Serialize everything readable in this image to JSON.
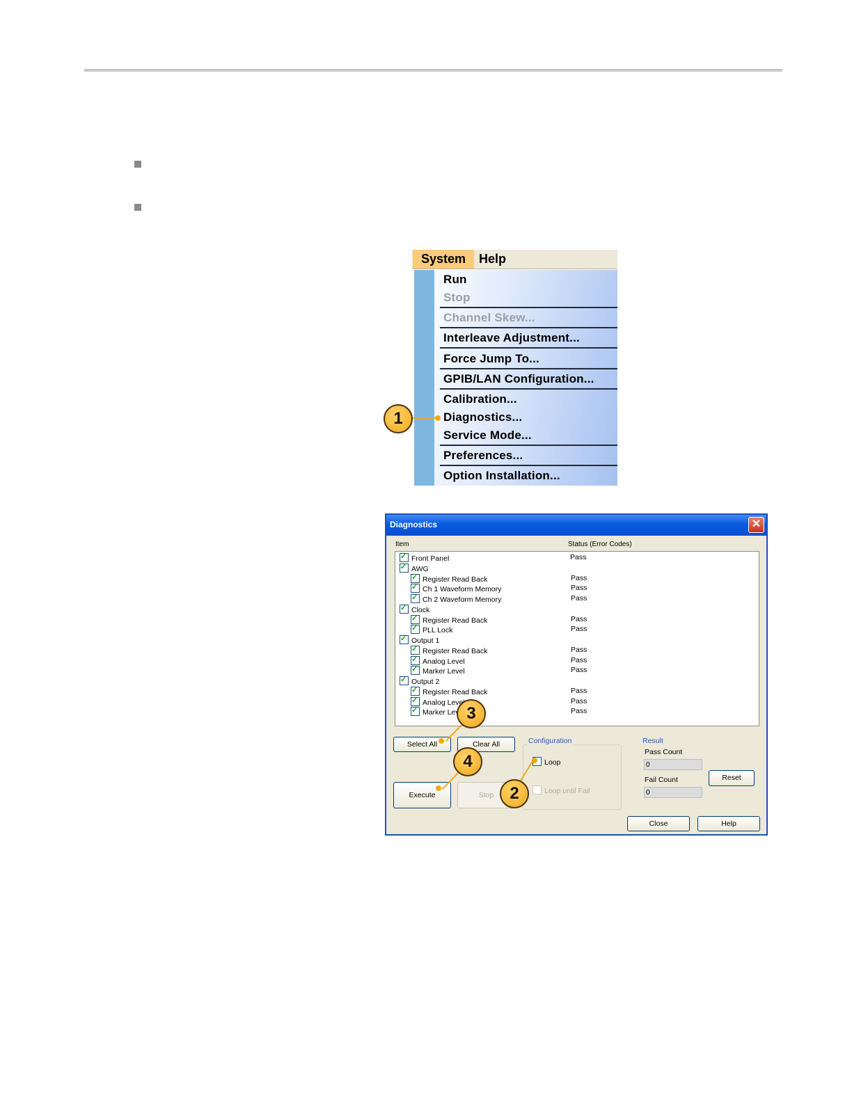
{
  "menu": {
    "bar": [
      "System",
      "Help"
    ],
    "items": [
      {
        "label": "Run",
        "enabled": true
      },
      {
        "label": "Stop",
        "enabled": false
      },
      {
        "label": "Channel Skew...",
        "enabled": false
      },
      {
        "label": "Interleave Adjustment...",
        "enabled": true
      },
      {
        "label": "Force Jump To...",
        "enabled": true
      },
      {
        "label": "GPIB/LAN Configuration...",
        "enabled": true
      },
      {
        "label": "Calibration...",
        "enabled": true
      },
      {
        "label": "Diagnostics...",
        "enabled": true
      },
      {
        "label": "Service Mode...",
        "enabled": true
      },
      {
        "label": "Preferences...",
        "enabled": true
      },
      {
        "label": "Option Installation...",
        "enabled": true
      }
    ]
  },
  "callouts": [
    "1",
    "2",
    "3",
    "4"
  ],
  "dialog": {
    "title": "Diagnostics",
    "close_glyph": "✕",
    "col_item": "Item",
    "col_status": "Status (Error Codes)",
    "rows": [
      {
        "label": "Front Panel",
        "status": "Pass",
        "level": 0
      },
      {
        "label": "AWG",
        "status": "",
        "level": 0
      },
      {
        "label": "Register Read Back",
        "status": "Pass",
        "level": 1
      },
      {
        "label": "Ch 1 Waveform Memory",
        "status": "Pass",
        "level": 1
      },
      {
        "label": "Ch 2 Waveform Memory",
        "status": "Pass",
        "level": 1
      },
      {
        "label": "Clock",
        "status": "",
        "level": 0
      },
      {
        "label": "Register Read Back",
        "status": "Pass",
        "level": 1
      },
      {
        "label": "PLL Lock",
        "status": "Pass",
        "level": 1
      },
      {
        "label": "Output 1",
        "status": "",
        "level": 0
      },
      {
        "label": "Register Read Back",
        "status": "Pass",
        "level": 1
      },
      {
        "label": "Analog Level",
        "status": "Pass",
        "level": 1
      },
      {
        "label": "Marker Level",
        "status": "Pass",
        "level": 1
      },
      {
        "label": "Output 2",
        "status": "",
        "level": 0
      },
      {
        "label": "Register Read Back",
        "status": "Pass",
        "level": 1
      },
      {
        "label": "Analog Level",
        "status": "Pass",
        "level": 1
      },
      {
        "label": "Marker Level",
        "status": "Pass",
        "level": 1
      }
    ],
    "select_all": "Select All",
    "clear_all": "Clear All",
    "execute": "Execute",
    "stop": "Stop",
    "configuration": "Configuration",
    "loop": "Loop",
    "loop_until_fail": "Loop until Fail",
    "result": "Result",
    "pass_count_label": "Pass Count",
    "pass_count": "0",
    "fail_count_label": "Fail Count",
    "fail_count": "0",
    "reset": "Reset",
    "close": "Close",
    "help": "Help"
  },
  "colors": {
    "callout": "#f0a81a",
    "menu_strip": "#7eb7e0",
    "title_bar": "#0a5ae0"
  }
}
